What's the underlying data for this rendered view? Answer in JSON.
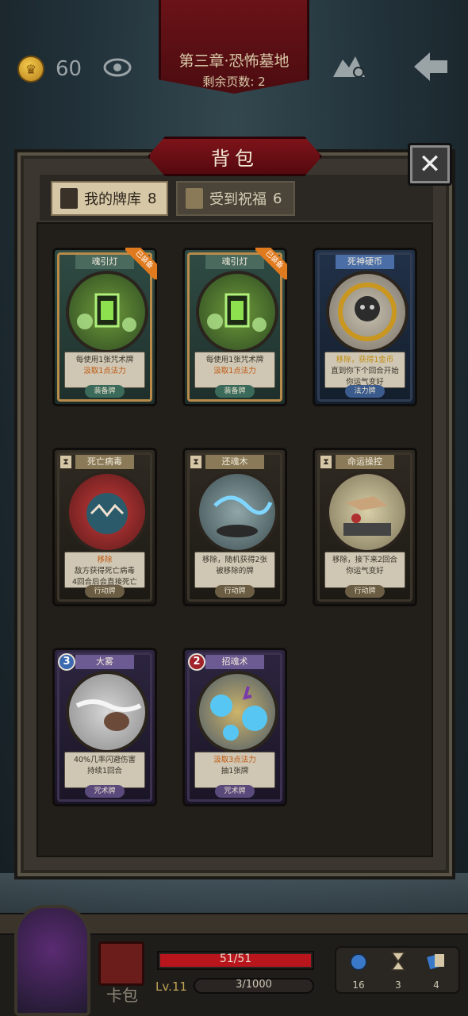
{
  "header": {
    "coins": "60",
    "chapter_title": "第三章·恐怖墓地",
    "pages_left": "剩余页数: 2"
  },
  "panel": {
    "title": "背包",
    "tabs": [
      {
        "label": "我的牌库",
        "count": "8"
      },
      {
        "label": "受到祝福",
        "count": "6"
      }
    ]
  },
  "cards": [
    {
      "name": "魂引灯",
      "badge": "已装备",
      "desc1": "每使用1张咒术牌",
      "desc2": "汲取1点法力",
      "type": "装备牌"
    },
    {
      "name": "魂引灯",
      "badge": "已装备",
      "desc1": "每使用1张咒术牌",
      "desc2": "汲取1点法力",
      "type": "装备牌"
    },
    {
      "name": "死神硬币",
      "desc1": "移除，获得1金币",
      "desc2": "直到你下个回合开始",
      "desc3": "你运气变好",
      "type": "法力牌"
    },
    {
      "name": "死亡病毒",
      "desc1": "移除",
      "desc2": "敌方获得死亡病毒",
      "desc3": "4回合后会直接死亡",
      "type": "行动牌"
    },
    {
      "name": "还魂木",
      "desc1": "移除，随机获得2张",
      "desc2": "被移除的牌",
      "type": "行动牌"
    },
    {
      "name": "命运操控",
      "desc1": "移除，接下来2回合",
      "desc2": "你运气变好",
      "type": "行动牌"
    },
    {
      "name": "大雾",
      "cost": "3",
      "desc1": "40%几率闪避伤害",
      "desc2": "持续1回合",
      "type": "咒术牌"
    },
    {
      "name": "招魂术",
      "cost": "2",
      "desc1": "汲取3点法力",
      "desc2": "抽1张牌",
      "type": "咒术牌"
    }
  ],
  "hud": {
    "cardbag_label": "卡包",
    "hp_text": "51/51",
    "hp_fraction": 1.0,
    "level": "Lv.11",
    "xp_text": "3/1000",
    "resources": [
      {
        "icon": "mana-orb-icon",
        "value": "16"
      },
      {
        "icon": "hourglass-icon",
        "value": "3"
      },
      {
        "icon": "cards-icon",
        "value": "4"
      }
    ]
  }
}
